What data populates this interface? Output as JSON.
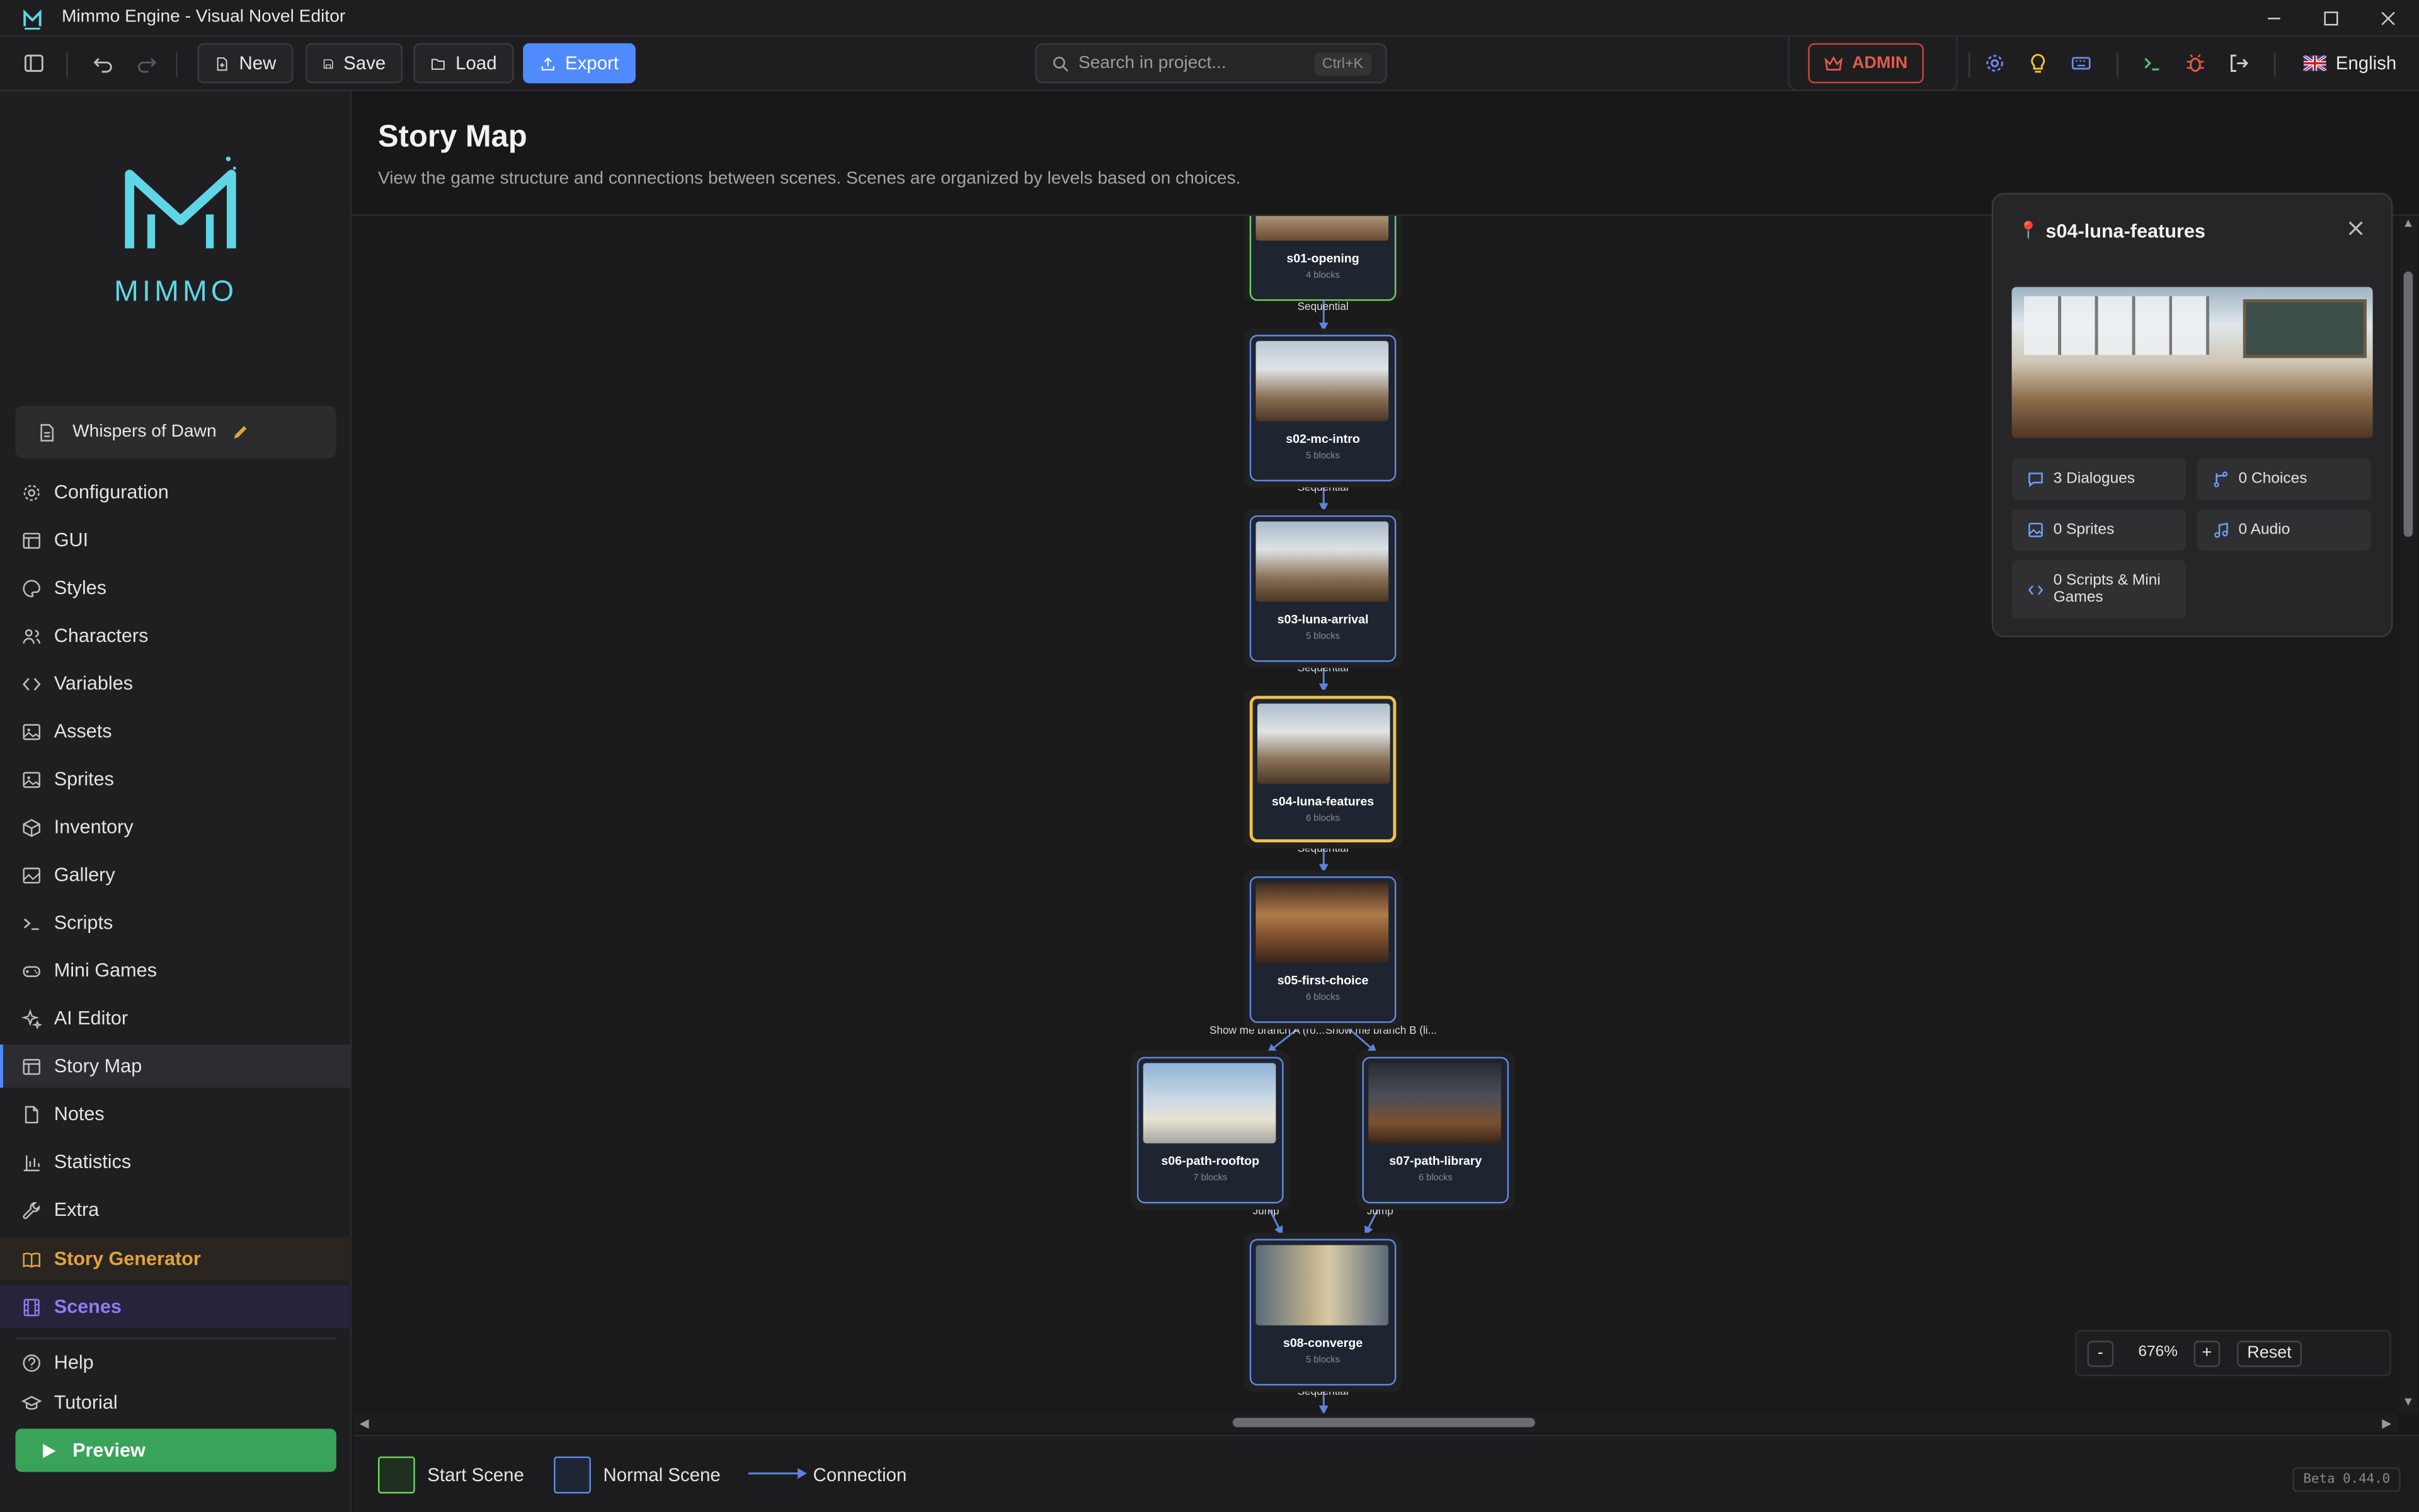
{
  "app": {
    "window_title": "Mimmo Engine - Visual Novel Editor"
  },
  "toolbar": {
    "new_label": "New",
    "save_label": "Save",
    "load_label": "Load",
    "export_label": "Export",
    "search_placeholder": "Search in project...",
    "search_shortcut": "Ctrl+K",
    "admin_label": "ADMIN",
    "language_label": "English"
  },
  "sidebar": {
    "logo_text": "MIMMO",
    "project_name": "Whispers of Dawn",
    "items": [
      {
        "label": "Configuration",
        "icon": "gear-icon"
      },
      {
        "label": "GUI",
        "icon": "layout-icon"
      },
      {
        "label": "Styles",
        "icon": "palette-icon"
      },
      {
        "label": "Characters",
        "icon": "users-icon"
      },
      {
        "label": "Variables",
        "icon": "code-icon"
      },
      {
        "label": "Assets",
        "icon": "image-icon"
      },
      {
        "label": "Sprites",
        "icon": "image-icon"
      },
      {
        "label": "Inventory",
        "icon": "box-icon"
      },
      {
        "label": "Gallery",
        "icon": "gallery-icon"
      },
      {
        "label": "Scripts",
        "icon": "terminal-icon"
      },
      {
        "label": "Mini Games",
        "icon": "gamepad-icon"
      },
      {
        "label": "AI Editor",
        "icon": "sparkles-icon"
      },
      {
        "label": "Story Map",
        "icon": "map-icon",
        "active": true
      },
      {
        "label": "Notes",
        "icon": "note-icon"
      },
      {
        "label": "Statistics",
        "icon": "chart-icon"
      },
      {
        "label": "Extra",
        "icon": "wrench-icon"
      }
    ],
    "story_generator_label": "Story Generator",
    "scenes_label": "Scenes",
    "help_label": "Help",
    "tutorial_label": "Tutorial",
    "preview_label": "Preview"
  },
  "main": {
    "title": "Story Map",
    "description": "View the game structure and connections between scenes. Scenes are organized by levels based on choices."
  },
  "story_map": {
    "scenes": [
      {
        "id": "s01-opening",
        "blocks": "4 blocks",
        "type": "start"
      },
      {
        "id": "s02-mc-intro",
        "blocks": "5 blocks",
        "type": "normal"
      },
      {
        "id": "s03-luna-arrival",
        "blocks": "5 blocks",
        "type": "normal"
      },
      {
        "id": "s04-luna-features",
        "blocks": "6 blocks",
        "type": "selected"
      },
      {
        "id": "s05-first-choice",
        "blocks": "6 blocks",
        "type": "normal"
      },
      {
        "id": "s06-path-rooftop",
        "blocks": "7 blocks",
        "type": "normal"
      },
      {
        "id": "s07-path-library",
        "blocks": "6 blocks",
        "type": "normal"
      },
      {
        "id": "s08-converge",
        "blocks": "5 blocks",
        "type": "normal"
      }
    ],
    "edge_labels": {
      "e1": "Sequential",
      "e2": "Sequential",
      "e3": "Sequential",
      "e4": "Sequential",
      "branch_a": "Show me branch A (ro...",
      "branch_b": "Show me branch B (li...",
      "jump_a": "Jump",
      "jump_b": "Jump",
      "e8": "Sequential"
    }
  },
  "details": {
    "title": "s04-luna-features",
    "stats": {
      "dialogues": "3 Dialogues",
      "choices": "0 Choices",
      "sprites": "0 Sprites",
      "audio": "0 Audio",
      "scripts": "0 Scripts & Mini Games"
    }
  },
  "zoom": {
    "minus": "-",
    "level": "676%",
    "plus": "+",
    "reset": "Reset"
  },
  "legend": {
    "start": "Start Scene",
    "normal": "Normal Scene",
    "connection": "Connection"
  },
  "version": "Beta 0.44.0",
  "colors": {
    "accent": "#4f8bff",
    "start_border": "#6fd35f",
    "selected_border": "#f2c04c",
    "admin": "#e45a4a",
    "story_generator": "#e0a33c",
    "scenes": "#8d7cf2",
    "preview": "#3aa35a"
  }
}
